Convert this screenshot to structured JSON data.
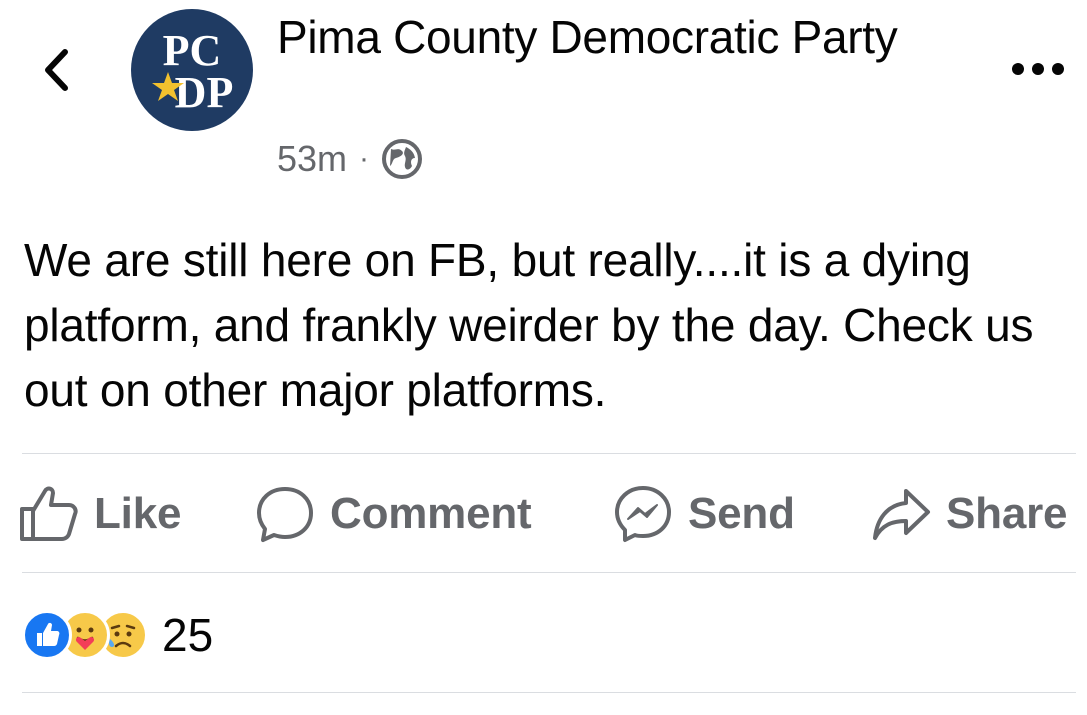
{
  "header": {
    "page_name": "Pima County Democratic Party",
    "avatar_logo_text": "PCDP",
    "timestamp": "53m",
    "separator": "·",
    "audience_icon": "globe-icon"
  },
  "post": {
    "text": "We are still here on FB, but really....it is a dying platform, and frankly weirder by the day. Check us out on other major platforms."
  },
  "actions": {
    "like_label": "Like",
    "comment_label": "Comment",
    "send_label": "Send",
    "share_label": "Share"
  },
  "reactions": {
    "types": [
      "like",
      "care",
      "sad"
    ],
    "count": "25"
  },
  "colors": {
    "avatar_bg": "#1f3b63",
    "secondary_text": "#65676b",
    "like_blue": "#1877f2",
    "divider": "#dadde1"
  }
}
